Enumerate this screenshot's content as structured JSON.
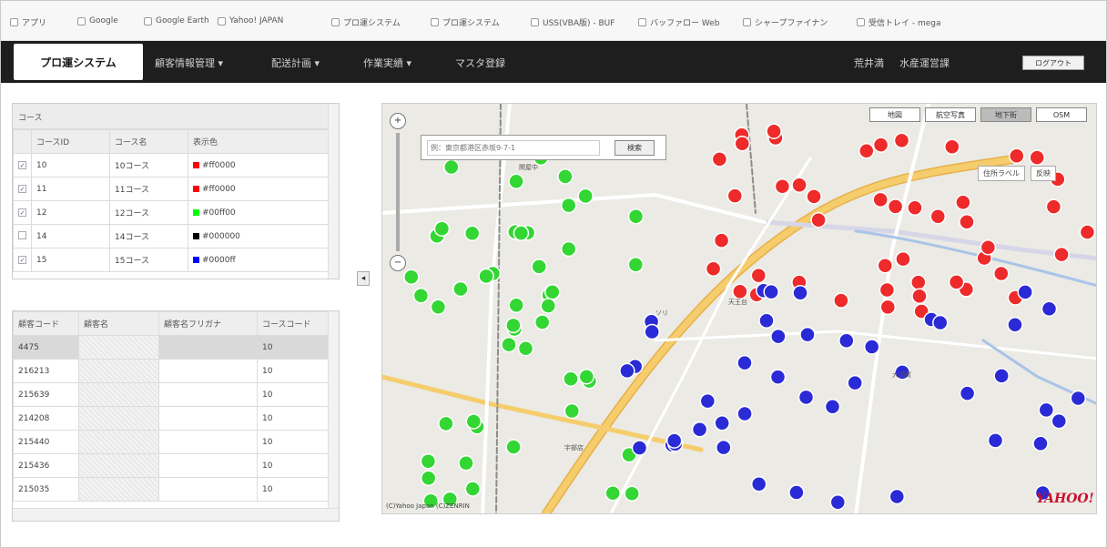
{
  "bookmarks": [
    {
      "label": "アプリ",
      "icon": "apps-icon"
    },
    {
      "label": "Google",
      "icon": "google-icon"
    },
    {
      "label": "Google Earth",
      "icon": "google-earth-icon"
    },
    {
      "label": "Yahoo! JAPAN",
      "icon": "yahoo-icon"
    },
    {
      "label": "プロ運システム",
      "icon": "page-icon"
    },
    {
      "label": "プロ運システム",
      "icon": "page-icon"
    },
    {
      "label": "USS(VBA版) - BUF",
      "icon": "page-icon"
    },
    {
      "label": "バッファロー Web",
      "icon": "page-icon"
    },
    {
      "label": "シャープファイナン",
      "icon": "page-icon"
    },
    {
      "label": "受信トレイ - mega",
      "icon": "gmail-icon"
    }
  ],
  "nav": {
    "brand": "プロ運システム",
    "menus": [
      "顧客情報管理 ▾",
      "配送計画 ▾",
      "作業実績 ▾",
      "マスタ登録"
    ],
    "user_name": "荒井満",
    "office": "水産運営課",
    "logout": "ログアウト"
  },
  "course_panel": {
    "title": "コース",
    "headers": [
      "",
      "コースID",
      "コース名",
      "表示色"
    ],
    "rows": [
      {
        "checked": true,
        "id": "10",
        "name": "10コース",
        "color_text": "#ff0000",
        "color": "#ff0000"
      },
      {
        "checked": true,
        "id": "11",
        "name": "11コース",
        "color_text": "#ff0000",
        "color": "#ff0000"
      },
      {
        "checked": true,
        "id": "12",
        "name": "12コース",
        "color_text": "#00ff00",
        "color": "#00ff00"
      },
      {
        "checked": false,
        "id": "14",
        "name": "14コース",
        "color_text": "#000000",
        "color": "#000000"
      },
      {
        "checked": true,
        "id": "15",
        "name": "15コース",
        "color_text": "#0000ff",
        "color": "#0000ff"
      }
    ]
  },
  "customer_panel": {
    "headers": [
      "顧客コード",
      "顧客名",
      "顧客名フリガナ",
      "コースコード"
    ],
    "rows": [
      {
        "code": "4475",
        "course": "10",
        "selected": true
      },
      {
        "code": "216213",
        "course": "10",
        "selected": false
      },
      {
        "code": "215639",
        "course": "10",
        "selected": false
      },
      {
        "code": "214208",
        "course": "10",
        "selected": false
      },
      {
        "code": "215440",
        "course": "10",
        "selected": false
      },
      {
        "code": "215436",
        "course": "10",
        "selected": false
      },
      {
        "code": "215035",
        "course": "10",
        "selected": false
      }
    ]
  },
  "map": {
    "search_placeholder": "例：東京都港区赤坂9-7-1",
    "search_button": "検索",
    "map_types": [
      "地図",
      "航空写真",
      "地下街",
      "OSM"
    ],
    "label_option": "住所ラベル",
    "label_apply": "反映",
    "copyright": "(C)Yahoo Japan (C)ZENRIN",
    "logo": "YAHOO!",
    "place_labels": [
      "関屋中",
      "ソリ",
      "天王台",
      "大須賀",
      "宇部店"
    ],
    "pin_colors": {
      "red": "#ee2a2a",
      "green": "#33d633",
      "blue": "#2a2ad6"
    }
  }
}
